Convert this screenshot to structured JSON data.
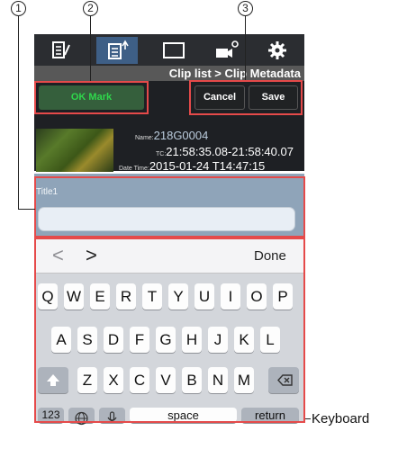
{
  "callouts": {
    "c1": "1",
    "c2": "2",
    "c3": "3"
  },
  "toolbar": {
    "icons": [
      "clip-list-icon",
      "clip-metadata-icon",
      "monitor-icon",
      "camera-settings-icon",
      "settings-gear-icon"
    ],
    "active_index": 1
  },
  "breadcrumb": "Clip list > Clip Metadata",
  "buttons": {
    "ok_mark": "OK Mark",
    "cancel": "Cancel",
    "save": "Save"
  },
  "clip": {
    "name_label": "Name:",
    "name": "218G0004",
    "tc_label": "TC:",
    "tc": "21:58:35.08-21:58:40.07",
    "date_label": "Date Time:",
    "date": "2015-01-24 T14:47:15"
  },
  "form": {
    "title_label": "Title1",
    "title_value": ""
  },
  "keyboard": {
    "prev": "<",
    "next": ">",
    "done": "Done",
    "row1": [
      "Q",
      "W",
      "E",
      "R",
      "T",
      "Y",
      "U",
      "I",
      "O",
      "P"
    ],
    "row2": [
      "A",
      "S",
      "D",
      "F",
      "G",
      "H",
      "J",
      "K",
      "L"
    ],
    "row3": [
      "Z",
      "X",
      "C",
      "V",
      "B",
      "N",
      "M"
    ],
    "numbers": "123",
    "space": "space",
    "return": "return"
  },
  "annotation": {
    "keyboard": "Keyboard"
  },
  "colors": {
    "highlight": "#e54a4a",
    "active_tab": "#3e5f86",
    "ok_text": "#2fd84c"
  }
}
